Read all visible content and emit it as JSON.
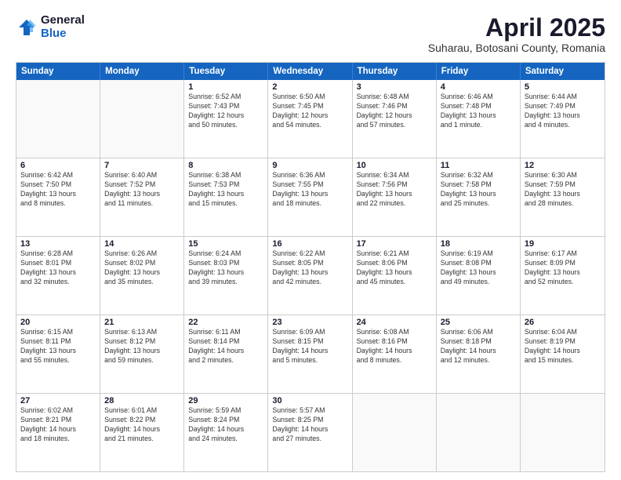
{
  "logo": {
    "general": "General",
    "blue": "Blue"
  },
  "title": "April 2025",
  "subtitle": "Suharau, Botosani County, Romania",
  "header_days": [
    "Sunday",
    "Monday",
    "Tuesday",
    "Wednesday",
    "Thursday",
    "Friday",
    "Saturday"
  ],
  "weeks": [
    [
      {
        "day": "",
        "text": ""
      },
      {
        "day": "",
        "text": ""
      },
      {
        "day": "1",
        "text": "Sunrise: 6:52 AM\nSunset: 7:43 PM\nDaylight: 12 hours\nand 50 minutes."
      },
      {
        "day": "2",
        "text": "Sunrise: 6:50 AM\nSunset: 7:45 PM\nDaylight: 12 hours\nand 54 minutes."
      },
      {
        "day": "3",
        "text": "Sunrise: 6:48 AM\nSunset: 7:46 PM\nDaylight: 12 hours\nand 57 minutes."
      },
      {
        "day": "4",
        "text": "Sunrise: 6:46 AM\nSunset: 7:48 PM\nDaylight: 13 hours\nand 1 minute."
      },
      {
        "day": "5",
        "text": "Sunrise: 6:44 AM\nSunset: 7:49 PM\nDaylight: 13 hours\nand 4 minutes."
      }
    ],
    [
      {
        "day": "6",
        "text": "Sunrise: 6:42 AM\nSunset: 7:50 PM\nDaylight: 13 hours\nand 8 minutes."
      },
      {
        "day": "7",
        "text": "Sunrise: 6:40 AM\nSunset: 7:52 PM\nDaylight: 13 hours\nand 11 minutes."
      },
      {
        "day": "8",
        "text": "Sunrise: 6:38 AM\nSunset: 7:53 PM\nDaylight: 13 hours\nand 15 minutes."
      },
      {
        "day": "9",
        "text": "Sunrise: 6:36 AM\nSunset: 7:55 PM\nDaylight: 13 hours\nand 18 minutes."
      },
      {
        "day": "10",
        "text": "Sunrise: 6:34 AM\nSunset: 7:56 PM\nDaylight: 13 hours\nand 22 minutes."
      },
      {
        "day": "11",
        "text": "Sunrise: 6:32 AM\nSunset: 7:58 PM\nDaylight: 13 hours\nand 25 minutes."
      },
      {
        "day": "12",
        "text": "Sunrise: 6:30 AM\nSunset: 7:59 PM\nDaylight: 13 hours\nand 28 minutes."
      }
    ],
    [
      {
        "day": "13",
        "text": "Sunrise: 6:28 AM\nSunset: 8:01 PM\nDaylight: 13 hours\nand 32 minutes."
      },
      {
        "day": "14",
        "text": "Sunrise: 6:26 AM\nSunset: 8:02 PM\nDaylight: 13 hours\nand 35 minutes."
      },
      {
        "day": "15",
        "text": "Sunrise: 6:24 AM\nSunset: 8:03 PM\nDaylight: 13 hours\nand 39 minutes."
      },
      {
        "day": "16",
        "text": "Sunrise: 6:22 AM\nSunset: 8:05 PM\nDaylight: 13 hours\nand 42 minutes."
      },
      {
        "day": "17",
        "text": "Sunrise: 6:21 AM\nSunset: 8:06 PM\nDaylight: 13 hours\nand 45 minutes."
      },
      {
        "day": "18",
        "text": "Sunrise: 6:19 AM\nSunset: 8:08 PM\nDaylight: 13 hours\nand 49 minutes."
      },
      {
        "day": "19",
        "text": "Sunrise: 6:17 AM\nSunset: 8:09 PM\nDaylight: 13 hours\nand 52 minutes."
      }
    ],
    [
      {
        "day": "20",
        "text": "Sunrise: 6:15 AM\nSunset: 8:11 PM\nDaylight: 13 hours\nand 55 minutes."
      },
      {
        "day": "21",
        "text": "Sunrise: 6:13 AM\nSunset: 8:12 PM\nDaylight: 13 hours\nand 59 minutes."
      },
      {
        "day": "22",
        "text": "Sunrise: 6:11 AM\nSunset: 8:14 PM\nDaylight: 14 hours\nand 2 minutes."
      },
      {
        "day": "23",
        "text": "Sunrise: 6:09 AM\nSunset: 8:15 PM\nDaylight: 14 hours\nand 5 minutes."
      },
      {
        "day": "24",
        "text": "Sunrise: 6:08 AM\nSunset: 8:16 PM\nDaylight: 14 hours\nand 8 minutes."
      },
      {
        "day": "25",
        "text": "Sunrise: 6:06 AM\nSunset: 8:18 PM\nDaylight: 14 hours\nand 12 minutes."
      },
      {
        "day": "26",
        "text": "Sunrise: 6:04 AM\nSunset: 8:19 PM\nDaylight: 14 hours\nand 15 minutes."
      }
    ],
    [
      {
        "day": "27",
        "text": "Sunrise: 6:02 AM\nSunset: 8:21 PM\nDaylight: 14 hours\nand 18 minutes."
      },
      {
        "day": "28",
        "text": "Sunrise: 6:01 AM\nSunset: 8:22 PM\nDaylight: 14 hours\nand 21 minutes."
      },
      {
        "day": "29",
        "text": "Sunrise: 5:59 AM\nSunset: 8:24 PM\nDaylight: 14 hours\nand 24 minutes."
      },
      {
        "day": "30",
        "text": "Sunrise: 5:57 AM\nSunset: 8:25 PM\nDaylight: 14 hours\nand 27 minutes."
      },
      {
        "day": "",
        "text": ""
      },
      {
        "day": "",
        "text": ""
      },
      {
        "day": "",
        "text": ""
      }
    ]
  ]
}
